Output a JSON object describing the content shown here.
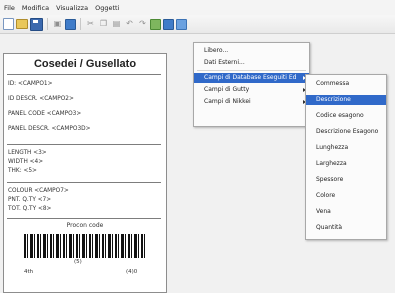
{
  "menubar": [
    "File",
    "Modifica",
    "Visualizza",
    "Oggetti"
  ],
  "label": {
    "title": "Cosedei / Gusellato",
    "group1": [
      "ID: <CAMPO1>",
      "ID DESCR. <CAMPO2>",
      "PANEL CODE <CAMPO3>",
      "PANEL DESCR. <CAMPO3D>"
    ],
    "group2": [
      "LENGTH <3>",
      "WIDTH <4>",
      "THK: <5>"
    ],
    "group3": [
      "COLOUR <CAMPO7>",
      "PNT. Q.TY <7>",
      "TOT. Q.TY <8>"
    ],
    "barcode_caption": "Procon code",
    "barcode_numbers": [
      "(5)",
      "4th",
      "(4)0"
    ]
  },
  "context_menu": {
    "items": [
      "Libero...",
      "Dati Esterni...",
      "Campi di Database Eseguiti Ed",
      "Campi di Gutty",
      "Campi di Nikkei"
    ]
  },
  "submenu": {
    "items": [
      "Commessa",
      "Descrizione",
      "Codice esagono",
      "Descrizione Esagono",
      "Lunghezza",
      "Larghezza",
      "Spessore",
      "Colore",
      "Vena",
      "Quantità"
    ],
    "selected_index": 1
  },
  "colors": {
    "selection": "#3069c9"
  }
}
